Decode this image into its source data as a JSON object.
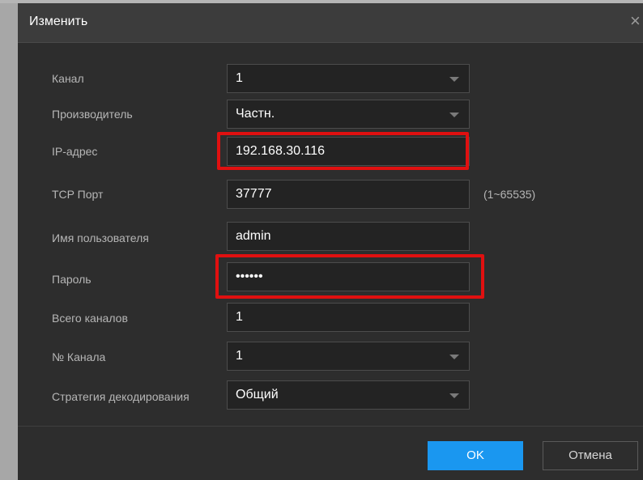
{
  "dialog": {
    "title": "Изменить",
    "close_label": "×"
  },
  "form": {
    "channel": {
      "label": "Канал",
      "value": "1"
    },
    "manufacturer": {
      "label": "Производитель",
      "value": "Частн."
    },
    "ip_address": {
      "label": "IP-адрес",
      "value": "192.168.30.116"
    },
    "tcp_port": {
      "label": "TCP Порт",
      "value": "37777",
      "hint": "(1~65535)"
    },
    "username": {
      "label": "Имя пользователя",
      "value": "admin"
    },
    "password": {
      "label": "Пароль",
      "value": "••••••"
    },
    "total_channels": {
      "label": "Всего каналов",
      "value": "1"
    },
    "channel_no": {
      "label": "№ Канала",
      "value": "1"
    },
    "decode_strategy": {
      "label": "Стратегия декодирования",
      "value": "Общий"
    }
  },
  "buttons": {
    "ok": "OK",
    "cancel": "Отмена"
  },
  "colors": {
    "accent": "#1a97f0",
    "highlight": "#e01010"
  }
}
